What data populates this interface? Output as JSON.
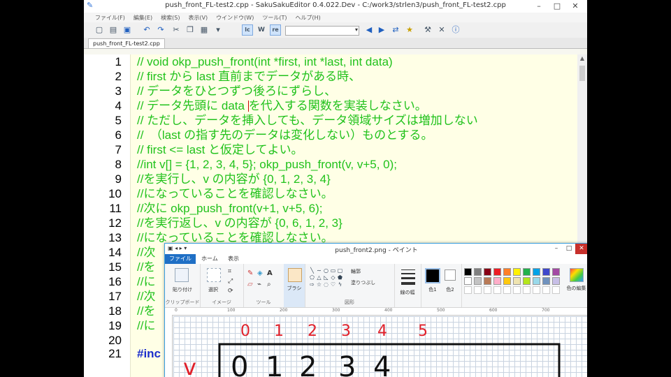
{
  "editor": {
    "title": "push_front_FL-test2.cpp - SakuSakuEditor 0.4.022.Dev - C:/work3/strlen3/push_front_FL-test2.cpp",
    "menu": [
      "ファイル(F)",
      "編集(E)",
      "検索(S)",
      "表示(V)",
      "ウインドウ(W)",
      "ツール(T)",
      "ヘルプ(H)"
    ],
    "tab": "push_front_FL-test2.cpp",
    "toolbar_mode_labels": [
      "lc",
      "W",
      "re"
    ],
    "lines": [
      {
        "n": "1",
        "text": "// void okp_push_front(int *first, int *last, int data)"
      },
      {
        "n": "2",
        "text": "// first から last 直前までデータがある時、"
      },
      {
        "n": "3",
        "text": "// データをひとつずつ後ろにずらし、"
      },
      {
        "n": "4",
        "text_a": "// データ先頭に data ",
        "text_b": "を代入する関数を実装しなさい。"
      },
      {
        "n": "5",
        "text": "// ただし、データを挿入しても、データ領域サイズは増加しない"
      },
      {
        "n": "6",
        "text": "//  （last の指す先のデータは変化しない）ものとする。"
      },
      {
        "n": "7",
        "text": "// first <= last と仮定してよい。"
      },
      {
        "n": "8",
        "text": "//int v[] = {1, 2, 3, 4, 5}; okp_push_front(v, v+5, 0);"
      },
      {
        "n": "9",
        "text": "//を実行し、v の内容が {0, 1, 2, 3, 4}"
      },
      {
        "n": "10",
        "text": "//になっていることを確認しなさい。"
      },
      {
        "n": "11",
        "text": "//次に okp_push_front(v+1, v+5, 6);"
      },
      {
        "n": "12",
        "text": "//を実行返し、v の内容が {0, 6, 1, 2, 3}"
      },
      {
        "n": "13",
        "text": "//になっていることを確認しなさい。"
      },
      {
        "n": "14",
        "text": "//次"
      },
      {
        "n": "15",
        "text": "//を"
      },
      {
        "n": "16",
        "text": "//に"
      },
      {
        "n": "17",
        "text": "//次"
      },
      {
        "n": "18",
        "text": "//を"
      },
      {
        "n": "19",
        "text": "//に"
      },
      {
        "n": "20",
        "text": ""
      },
      {
        "n": "21",
        "text": "#inc"
      }
    ]
  },
  "paint": {
    "title": "push_front2.png - ペイント",
    "tabs": [
      "ファイル",
      "ホーム",
      "表示"
    ],
    "groups": {
      "clipboard": "クリップボード",
      "image": "イメージ",
      "tools": "ツール",
      "shapes": "図形"
    },
    "buttons": {
      "paste": "貼り付け",
      "select": "選択",
      "brush": "ブラシ",
      "outline": "輪郭",
      "fill": "塗りつぶし",
      "size": "線の幅",
      "color1": "色1",
      "color2": "色2",
      "edit_colors": "色の編集"
    },
    "ruler_ticks": [
      "0",
      "100",
      "200",
      "300",
      "400",
      "500",
      "600",
      "700",
      "800"
    ],
    "palette": [
      "#000000",
      "#7f7f7f",
      "#880015",
      "#ed1c24",
      "#ff7f27",
      "#fff200",
      "#22b14c",
      "#00a2e8",
      "#3f48cc",
      "#a349a4",
      "#ffffff",
      "#c3c3c3",
      "#b97a57",
      "#ffaec9",
      "#ffc90e",
      "#efe4b0",
      "#b5e61d",
      "#99d9ea",
      "#7092be",
      "#c8bfe7"
    ],
    "drawing": {
      "indices": [
        "0",
        "1",
        "2",
        "3",
        "4",
        "5"
      ],
      "var_label": "v",
      "cell_values": [
        "0",
        "1",
        "2",
        "3",
        "4"
      ]
    }
  }
}
